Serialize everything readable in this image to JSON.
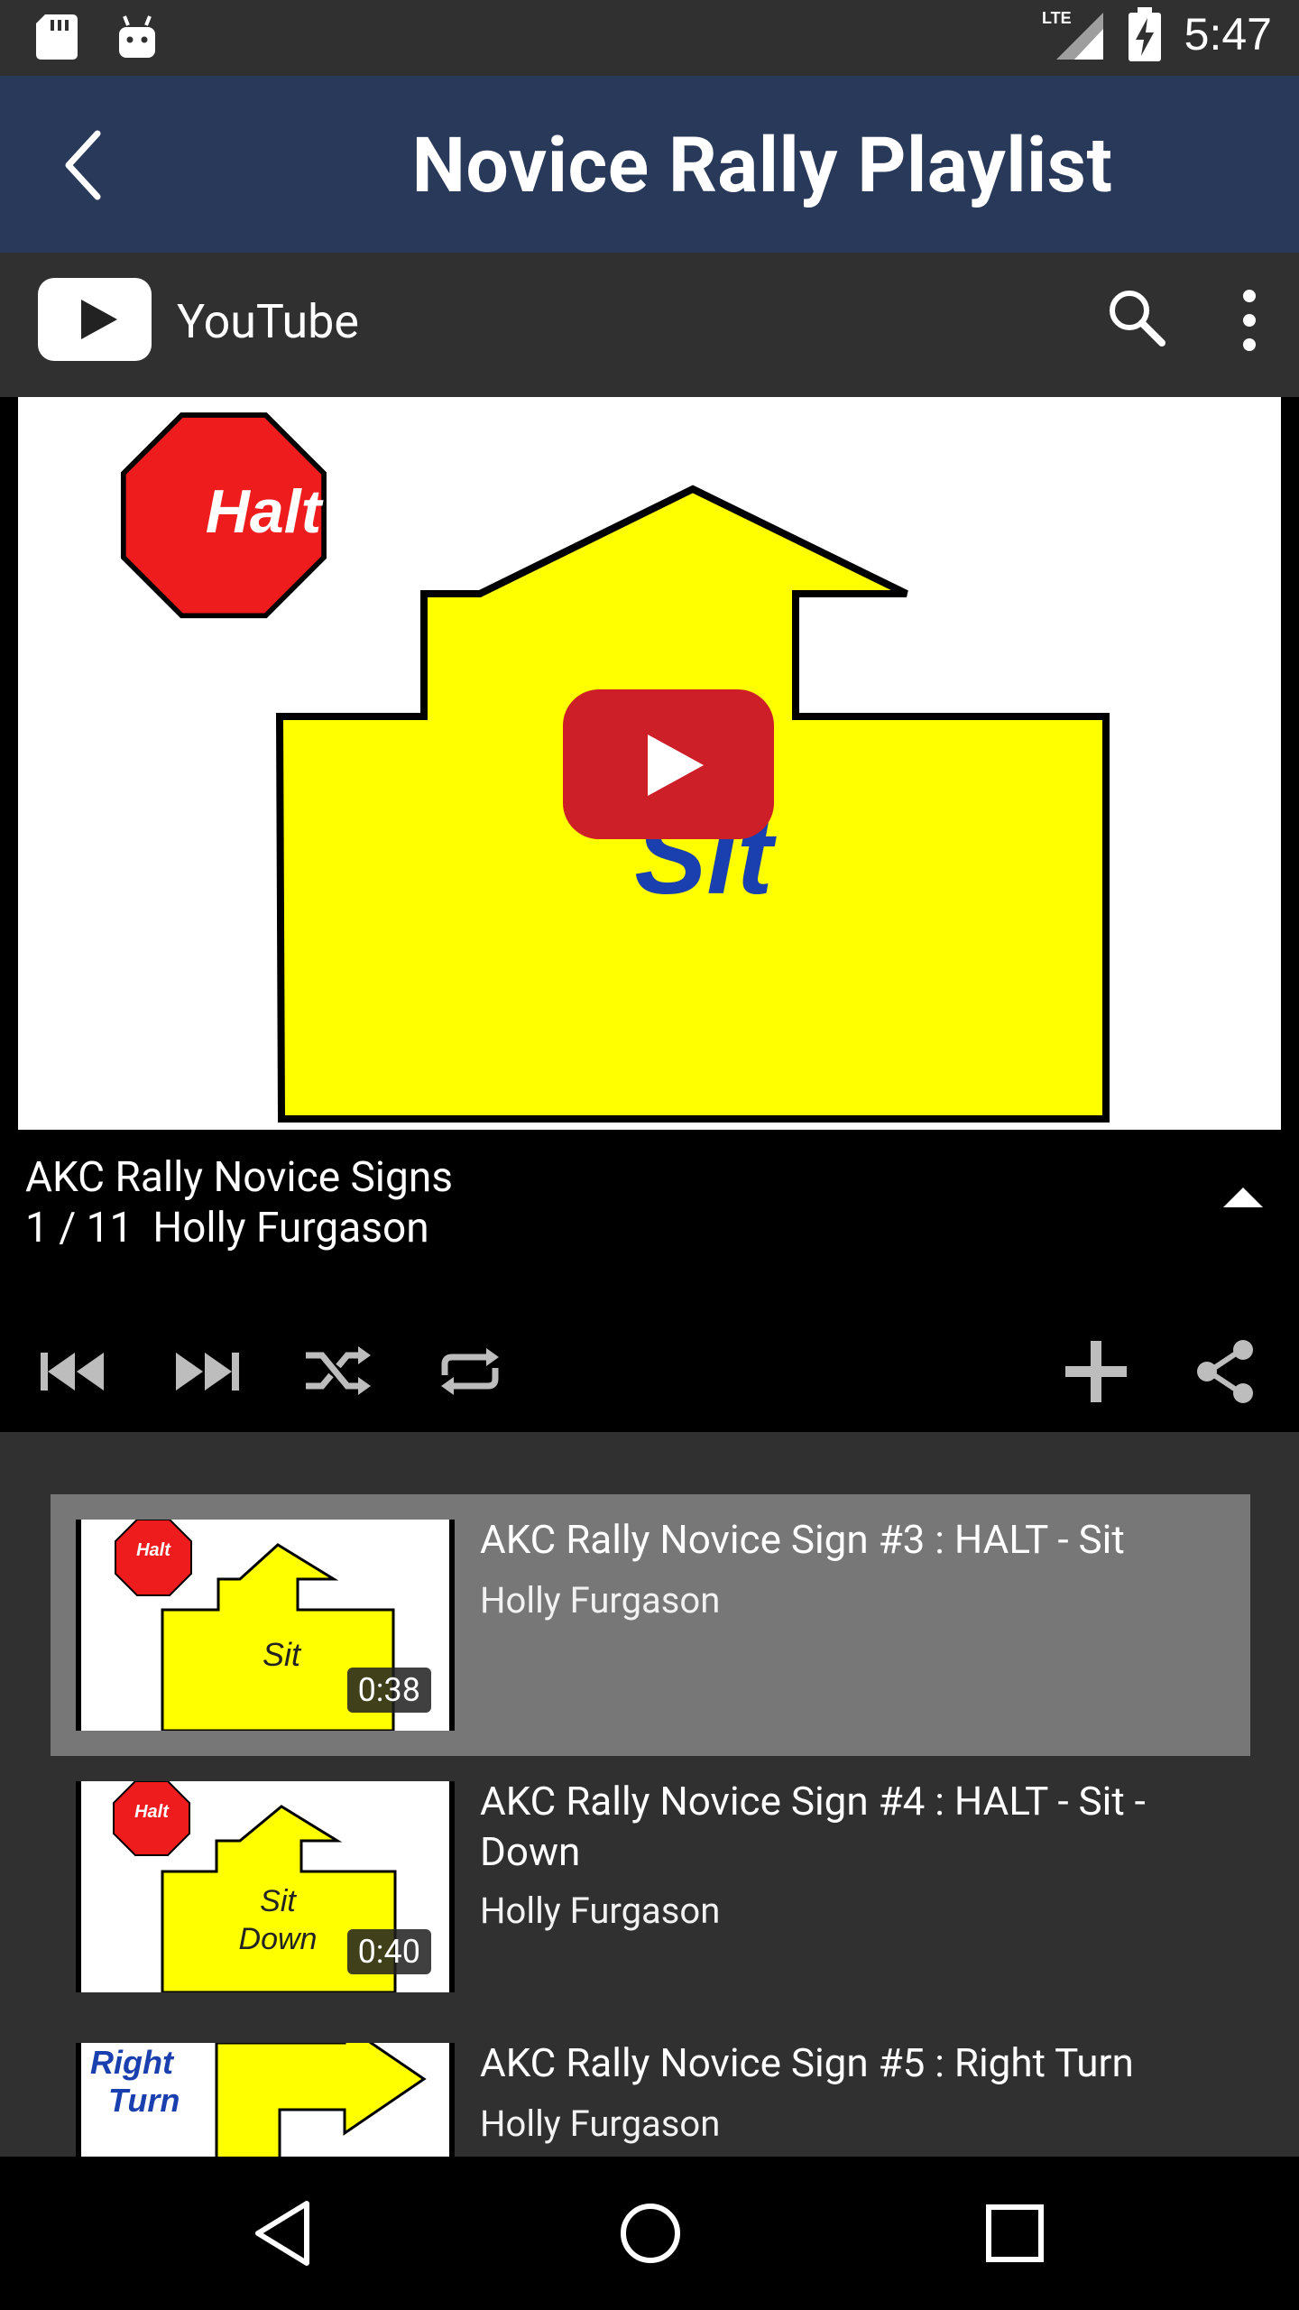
{
  "status": {
    "time": "5:47",
    "network": "LTE"
  },
  "appbar": {
    "title": "Novice Rally Playlist"
  },
  "youtube": {
    "name": "YouTube"
  },
  "player": {
    "thumb_sign_top": "Halt",
    "thumb_sign_main": "Sit",
    "video_title": "AKC Rally Novice Signs",
    "position": "1 / 11",
    "author": "Holly Furgason"
  },
  "playlist": {
    "items": [
      {
        "title": "AKC Rally Novice Sign #3 : HALT - Sit",
        "author": "Holly Furgason",
        "duration": "0:38",
        "sign_top": "Halt",
        "sign_main": "Sit",
        "active": true
      },
      {
        "title": "AKC Rally Novice Sign #4 : HALT - Sit - Down",
        "author": "Holly Furgason",
        "duration": "0:40",
        "sign_top": "Halt",
        "sign_main_1": "Sit",
        "sign_main_2": "Down"
      },
      {
        "title": "AKC Rally Novice Sign #5 : Right Turn",
        "author": "Holly Furgason",
        "duration": "",
        "sign_1": "Right",
        "sign_2": "Turn"
      }
    ]
  },
  "colors": {
    "appbar": "#29395a",
    "youtube_red": "#cd1f27",
    "sign_yellow": "#ffff00",
    "sign_red": "#ee1c1c",
    "sign_blue": "#1a3fae"
  }
}
